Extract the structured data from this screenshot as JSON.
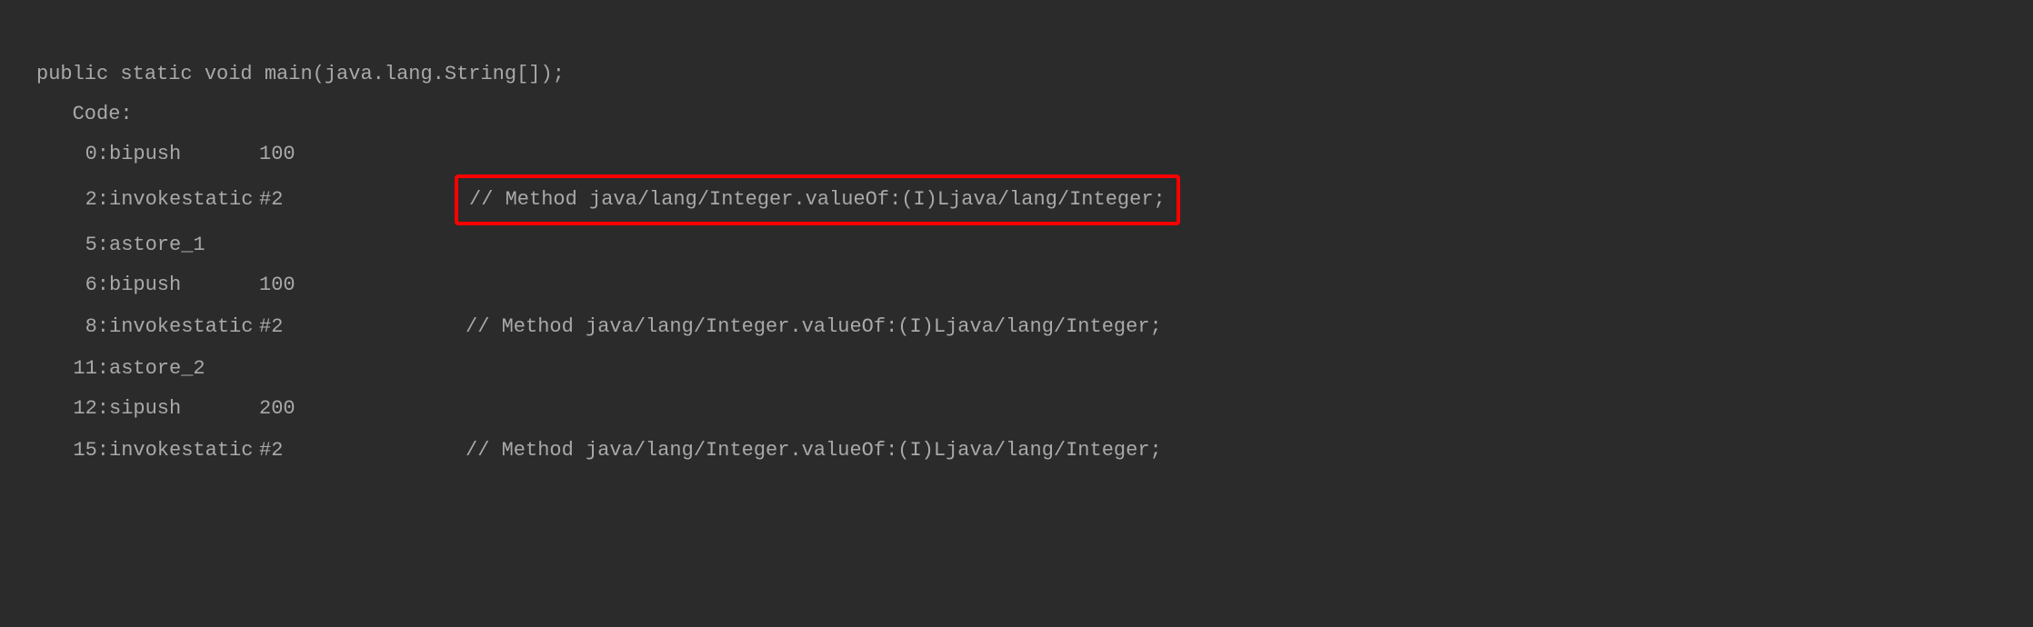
{
  "header": {
    "signature": "public static void main(java.lang.String[]);",
    "code_label": "   Code:"
  },
  "instructions": [
    {
      "offset": "0:",
      "opcode": "bipush",
      "arg": "100",
      "comment": "",
      "highlighted": false
    },
    {
      "offset": "2:",
      "opcode": "invokestatic",
      "arg": "#2",
      "comment": "// Method java/lang/Integer.valueOf:(I)Ljava/lang/Integer;",
      "highlighted": true
    },
    {
      "offset": "5:",
      "opcode": "astore_1",
      "arg": "",
      "comment": "",
      "highlighted": false
    },
    {
      "offset": "6:",
      "opcode": "bipush",
      "arg": "100",
      "comment": "",
      "highlighted": false
    },
    {
      "offset": "8:",
      "opcode": "invokestatic",
      "arg": "#2",
      "comment": "// Method java/lang/Integer.valueOf:(I)Ljava/lang/Integer;",
      "highlighted": false
    },
    {
      "offset": "11:",
      "opcode": "astore_2",
      "arg": "",
      "comment": "",
      "highlighted": false
    },
    {
      "offset": "12:",
      "opcode": "sipush",
      "arg": "200",
      "comment": "",
      "highlighted": false
    },
    {
      "offset": "15:",
      "opcode": "invokestatic",
      "arg": "#2",
      "comment": "// Method java/lang/Integer.valueOf:(I)Ljava/lang/Integer;",
      "highlighted": false
    }
  ]
}
